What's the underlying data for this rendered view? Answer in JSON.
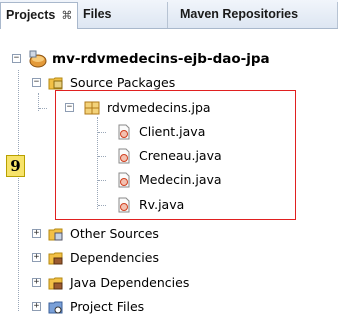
{
  "tabs": [
    {
      "label": "Projects",
      "close": "⌘"
    },
    {
      "label": "Files"
    },
    {
      "label": "Maven Repositories"
    }
  ],
  "tree": {
    "project": "mv-rdvmedecins-ejb-dao-jpa",
    "source_packages": "Source Packages",
    "package": "rdvmedecins.jpa",
    "files": [
      "Client.java",
      "Creneau.java",
      "Medecin.java",
      "Rv.java"
    ],
    "other_sources": "Other Sources",
    "dependencies": "Dependencies",
    "java_dependencies": "Java Dependencies",
    "project_files": "Project Files"
  },
  "annotation": {
    "badge": "9",
    "highlight_color": "#e02020"
  }
}
